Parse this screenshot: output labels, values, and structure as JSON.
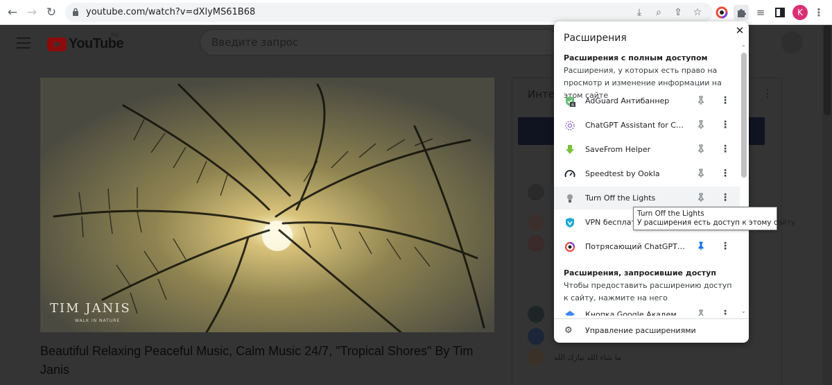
{
  "browser": {
    "url": "youtube.com/watch?v=dXlyMS61B68",
    "profile_initial": "K"
  },
  "youtube": {
    "logo_text": "YouTube",
    "logo_region": "RU",
    "search_placeholder": "Введите запрос",
    "video_overlay_title": "TIM JANIS",
    "video_overlay_subtitle": "WALK IN NATURE",
    "video_title": "Beautiful Relaxing Peaceful Music, Calm Music 24/7, \"Tropical Shores\" By Tim Janis",
    "chat_header": "Инте",
    "chat_message": "ما شاء الله تبارك الله"
  },
  "extensions_popup": {
    "title": "Расширения",
    "full_access_heading": "Расширения с полным доступом",
    "full_access_desc": "Расширения, у которых есть право на просмотр и изменение информации на этом сайте",
    "full_access_items": [
      {
        "name": "AdGuard Антибаннер",
        "pinned": false,
        "badge": "6",
        "icon_color": "#68bc71"
      },
      {
        "name": "ChatGPT Assistant for Chrome",
        "pinned": false,
        "icon_color": "#8e6cd1"
      },
      {
        "name": "SaveFrom Helper",
        "pinned": false,
        "icon_color": "#77c33a"
      },
      {
        "name": "Speedtest by Ookla",
        "pinned": false,
        "icon_color": "#141526"
      },
      {
        "name": "Turn Off the Lights",
        "pinned": false,
        "icon_color": "#888888"
      },
      {
        "name": "VPN бесплатный",
        "pinned": false,
        "icon_color": "#1aa6d6"
      },
      {
        "name": "Потрясающий ChatGPT Скриншот",
        "pinned": true,
        "icon_color": "#e94a3a"
      }
    ],
    "requested_access_heading": "Расширения, запросившие доступ",
    "requested_access_desc": "Чтобы предоставить расширению доступ к сайту, нажмите на него",
    "requested_access_items": [
      {
        "name": "Кнопка Google Академии",
        "pinned": false,
        "icon_color": "#4285f4"
      }
    ],
    "manage_label": "Управление расширениями"
  },
  "tooltip": {
    "line1": "Turn Off the Lights",
    "line2": "У расширения есть доступ к этому сайту"
  },
  "colors": {
    "pin_active": "#1a73e8",
    "pin_inactive": "#5f6368"
  }
}
